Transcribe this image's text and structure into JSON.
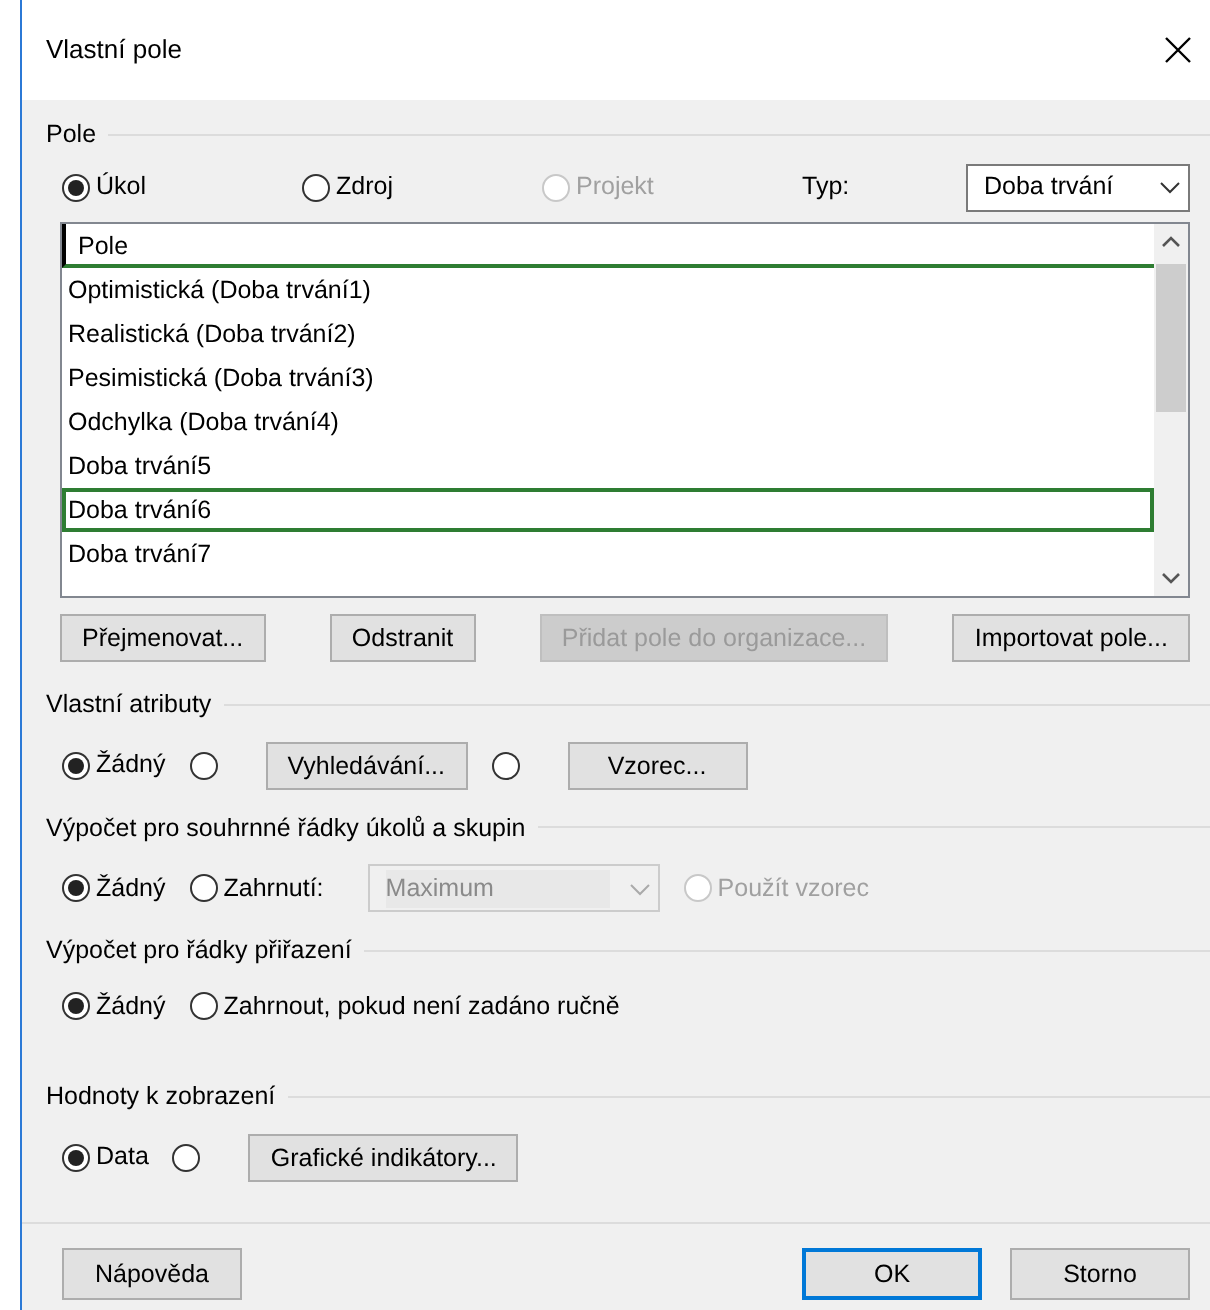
{
  "window": {
    "title": "Vlastní pole"
  },
  "fields": {
    "legend": "Pole",
    "scope_options": [
      {
        "label": "Úkol",
        "selected": true,
        "disabled": false
      },
      {
        "label": "Zdroj",
        "selected": false,
        "disabled": false
      },
      {
        "label": "Projekt",
        "selected": false,
        "disabled": true
      }
    ],
    "type_label": "Typ:",
    "type_value": "Doba trvání",
    "list": {
      "header": "Pole",
      "items": [
        {
          "label": "Optimistická (Doba trvání1)",
          "selected": false
        },
        {
          "label": "Realistická (Doba trvání2)",
          "selected": false
        },
        {
          "label": "Pesimistická (Doba trvání3)",
          "selected": false
        },
        {
          "label": "Odchylka (Doba trvání4)",
          "selected": false
        },
        {
          "label": "Doba trvání5",
          "selected": false
        },
        {
          "label": "Doba trvání6",
          "selected": true
        },
        {
          "label": "Doba trvání7",
          "selected": false
        }
      ]
    },
    "buttons": [
      {
        "label": "Přejmenovat...",
        "disabled": false
      },
      {
        "label": "Odstranit",
        "disabled": false
      },
      {
        "label": "Přidat pole do organizace...",
        "disabled": true
      },
      {
        "label": "Importovat pole...",
        "disabled": false
      }
    ]
  },
  "custom_attributes": {
    "legend": "Vlastní atributy",
    "options": [
      {
        "label": "Žádný",
        "selected": true
      },
      {
        "selected": false,
        "button": "Vyhledávání..."
      },
      {
        "selected": false,
        "button": "Vzorec..."
      }
    ]
  },
  "summary_rows": {
    "legend": "Výpočet pro souhrnné řádky úkolů a skupin",
    "options": [
      {
        "label": "Žádný",
        "selected": true,
        "disabled": false
      },
      {
        "label": "Zahrnutí:",
        "selected": false,
        "disabled": false,
        "dropdown": "Maximum"
      },
      {
        "label": "Použít vzorec",
        "selected": false,
        "disabled": true
      }
    ]
  },
  "assignment_rows": {
    "legend": "Výpočet pro řádky přiřazení",
    "options": [
      {
        "label": "Žádný",
        "selected": true
      },
      {
        "label": "Zahrnout, pokud není zadáno ručně",
        "selected": false
      }
    ]
  },
  "display_values": {
    "legend": "Hodnoty k zobrazení",
    "options": [
      {
        "label": "Data",
        "selected": true
      },
      {
        "selected": false,
        "button": "Grafické indikátory..."
      }
    ]
  },
  "footer_buttons": [
    {
      "label": "Nápověda",
      "default": false
    },
    {
      "label": "OK",
      "default": true
    },
    {
      "label": "Storno",
      "default": false
    }
  ]
}
